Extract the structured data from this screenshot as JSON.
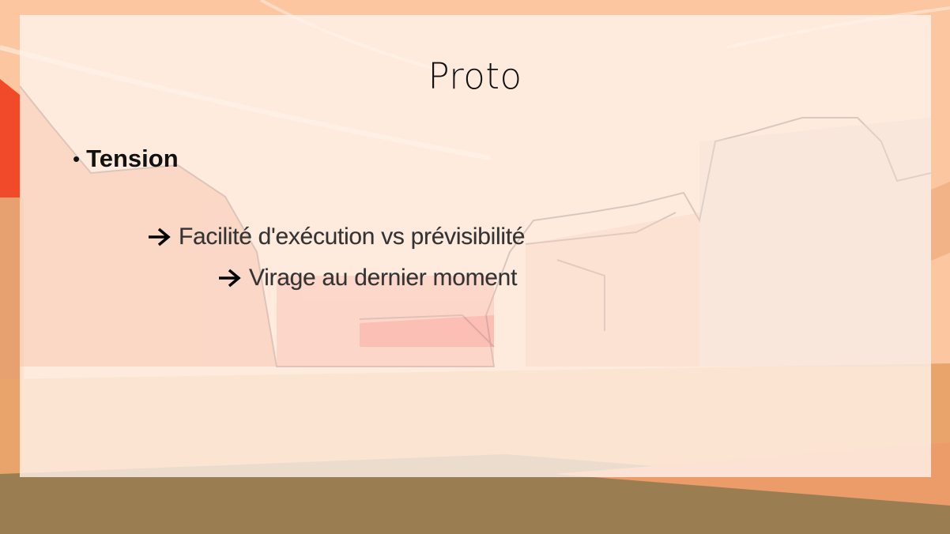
{
  "slide": {
    "title": "Proto",
    "bullet": {
      "dot": "•",
      "label": "Tension"
    },
    "sub_items": [
      {
        "icon": "arrow-right-icon",
        "text": "Facilité d'exécution vs prévisibilité"
      },
      {
        "icon": "arrow-right-icon",
        "text": "Virage au dernier moment"
      }
    ]
  },
  "colors": {
    "background_sky": "#fbc49a",
    "background_ground": "#9b7d52",
    "rock_red": "#f04a2a",
    "panel": "#fff4ec"
  }
}
